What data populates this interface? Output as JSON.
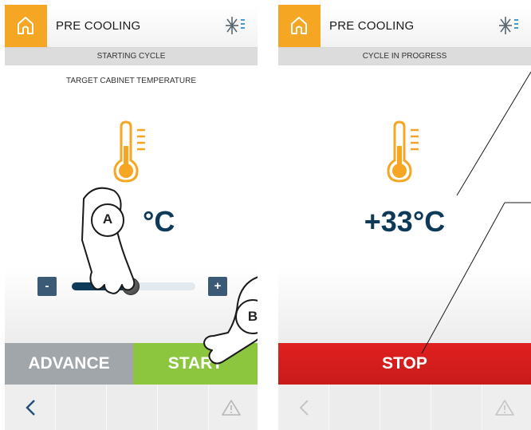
{
  "left_screen": {
    "header": {
      "title": "PRE COOLING",
      "home_icon": "home-icon",
      "mode_icon": "snowflake-cooling-icon"
    },
    "status": "STARTING CYCLE",
    "target_label": "TARGET CABINET TEMPERATURE",
    "temperature_unit_visible": "°C",
    "slider": {
      "minus_label": "-",
      "plus_label": "+",
      "level_fraction": 0.48
    },
    "buttons": {
      "advance": "ADVANCE",
      "start": "START"
    },
    "nav": {
      "back_icon": "chevron-left-icon",
      "alert_icon": "warning-triangle-icon"
    },
    "callouts": {
      "a": "A",
      "b": "B"
    }
  },
  "right_screen": {
    "header": {
      "title": "PRE COOLING",
      "home_icon": "home-icon",
      "mode_icon": "snowflake-cooling-icon"
    },
    "status": "CYCLE IN PROGRESS",
    "temperature": "+33°C",
    "buttons": {
      "stop": "STOP"
    },
    "nav": {
      "back_icon": "chevron-left-icon",
      "alert_icon": "warning-triangle-icon"
    }
  },
  "colors": {
    "home_orange": "#f5a623",
    "start_green": "#8cc63f",
    "advance_gray": "#a1a6ab",
    "stop_red": "#d81e1e",
    "temp_navy": "#0e3a5a",
    "thermo_orange": "#f5a623"
  }
}
